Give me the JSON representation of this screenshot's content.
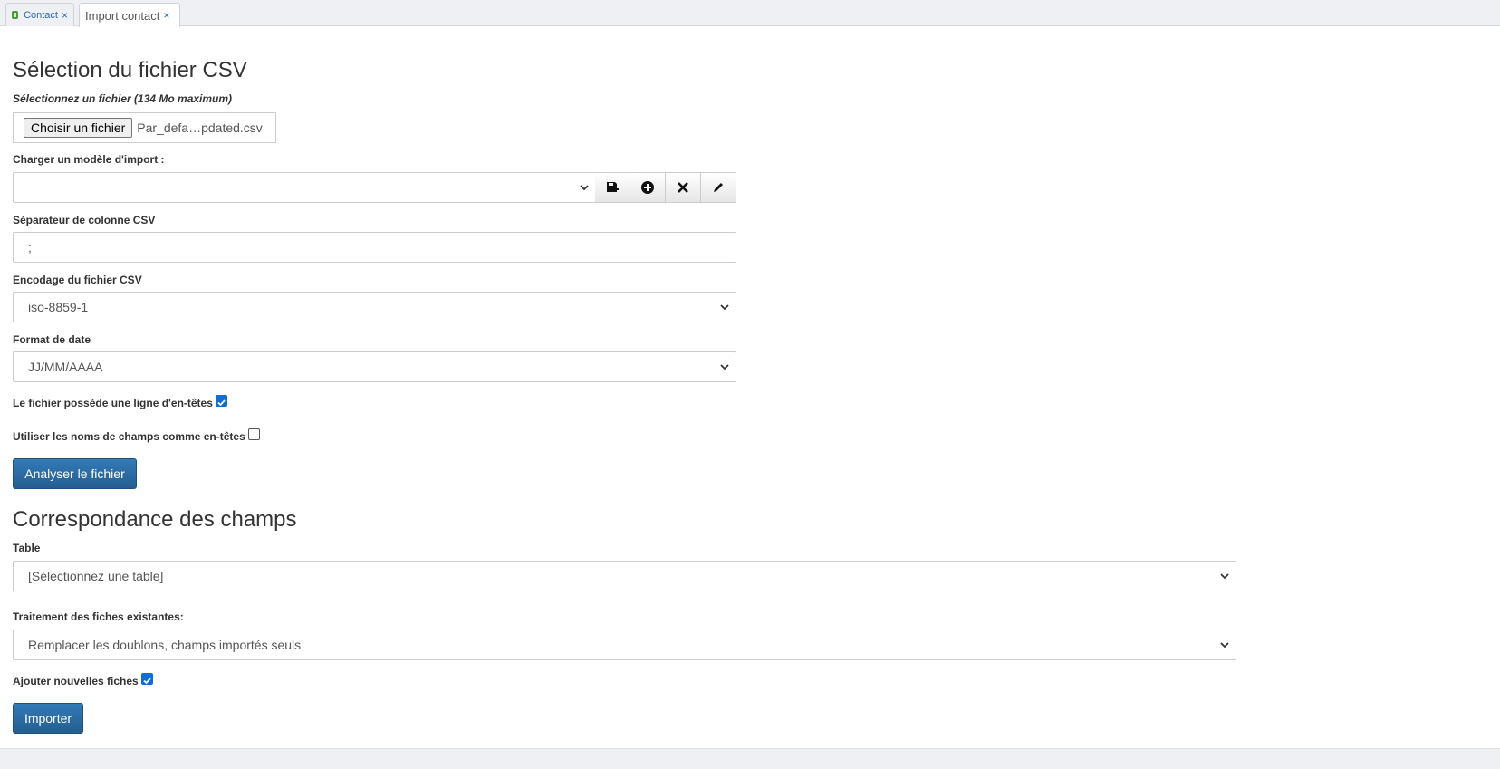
{
  "tabs": [
    {
      "label": "Contact",
      "close": "×"
    },
    {
      "label": "Import contact",
      "close": "×"
    }
  ],
  "section1": {
    "title": "Sélection du fichier CSV",
    "file_label": "Sélectionnez un fichier (134 Mo maximum)",
    "file_button": "Choisir un fichier",
    "file_name": "Par_defa…pdated.csv",
    "model_label": "Charger un modèle d'import :",
    "model_value": "",
    "model_buttons": [
      "save-import-icon",
      "add-circle-icon",
      "delete-icon",
      "edit-pencil-icon"
    ],
    "separator_label": "Séparateur de colonne CSV",
    "separator_value": ";",
    "encoding_label": "Encodage du fichier CSV",
    "encoding_value": "iso-8859-1",
    "date_label": "Format de date",
    "date_value": "JJ/MM/AAAA",
    "header_row_label": "Le fichier possède une ligne d'en-têtes",
    "header_row_checked": true,
    "field_names_label": "Utiliser les noms de champs comme en-têtes",
    "field_names_checked": false,
    "analyze_button": "Analyser le fichier"
  },
  "section2": {
    "title": "Correspondance des champs",
    "table_label": "Table",
    "table_value": "[Sélectionnez une table]",
    "existing_label": "Traitement des fiches existantes:",
    "existing_value": "Remplacer les doublons, champs importés seuls",
    "add_new_label": "Ajouter nouvelles fiches",
    "add_new_checked": true,
    "import_button": "Importer"
  },
  "colors": {
    "primary_button": "#337ab7",
    "checkbox_checked": "#0b6fd8",
    "tab_link": "#2a6ab0"
  }
}
